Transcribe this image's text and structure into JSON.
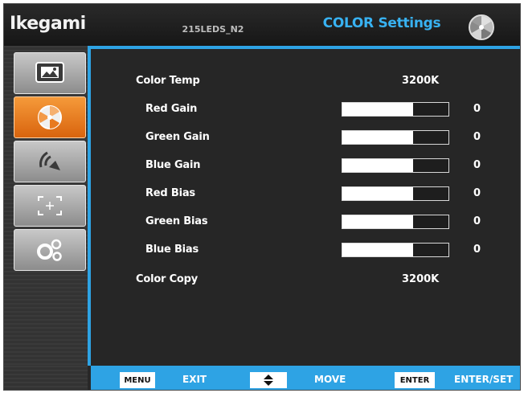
{
  "header": {
    "brand": "Ikegami",
    "model": "215LEDS_N2",
    "title": "COLOR Settings",
    "icon": "color-wheel-icon"
  },
  "sidebar": {
    "items": [
      {
        "name": "picture",
        "icon": "picture-icon",
        "active": false
      },
      {
        "name": "color",
        "icon": "color-wheel-icon",
        "active": true
      },
      {
        "name": "audio",
        "icon": "audio-icon",
        "active": false
      },
      {
        "name": "marker",
        "icon": "marker-icon",
        "active": false
      },
      {
        "name": "system",
        "icon": "gears-icon",
        "active": false
      }
    ]
  },
  "settings": {
    "color_temp": {
      "label": "Color Temp",
      "value": "3200K"
    },
    "gains": [
      {
        "label": "Red Gain",
        "value": "0",
        "level": 0.67
      },
      {
        "label": "Green Gain",
        "value": "0",
        "level": 0.67
      },
      {
        "label": "Blue Gain",
        "value": "0",
        "level": 0.67
      },
      {
        "label": "Red Bias",
        "value": "0",
        "level": 0.67
      },
      {
        "label": "Green Bias",
        "value": "0",
        "level": 0.67
      },
      {
        "label": "Blue Bias",
        "value": "0",
        "level": 0.67
      }
    ],
    "color_copy": {
      "label": "Color Copy",
      "value": "3200K"
    }
  },
  "footer": {
    "menu_key": "MENU",
    "menu_action": "EXIT",
    "move_key_icon": "up-down-arrows-icon",
    "move_action": "MOVE",
    "enter_key": "ENTER",
    "enter_action": "ENTER/SET"
  },
  "colors": {
    "accent": "#2ea3e4",
    "title": "#38b2f2",
    "active_tab": "#e8791f",
    "background": "#262626"
  }
}
